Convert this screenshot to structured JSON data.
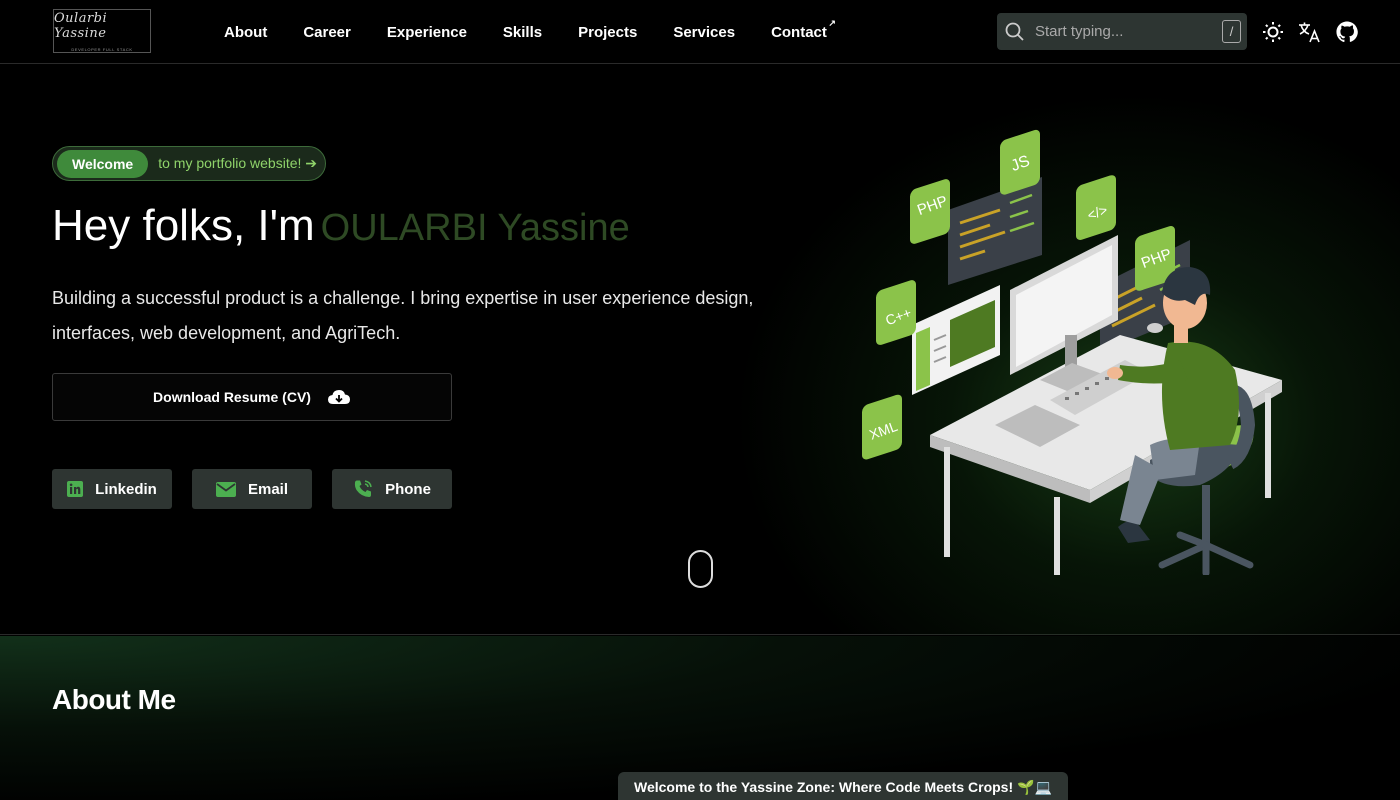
{
  "header": {
    "logo_text": "Oularbi Yassine",
    "logo_subtitle": "Developer Full Stack",
    "nav": [
      "About",
      "Career",
      "Experience",
      "Skills",
      "Projects",
      "Services",
      "Contact"
    ],
    "contact_external_marker": "↗",
    "search_placeholder": "Start typing...",
    "search_shortcut": "/"
  },
  "hero": {
    "welcome_badge": "Welcome",
    "welcome_text": "to my portfolio website! ➔",
    "greeting": "Hey folks, I'm",
    "name": "OULARBI Yassine",
    "description": "Building a successful product is a challenge. I bring expertise in user experience design, interfaces, web development, and AgriTech.",
    "cv_button": "Download Resume (CV)",
    "social": [
      "Linkedin",
      "Email",
      "Phone"
    ],
    "illustration_tags": [
      "JS",
      "PHP",
      "</>",
      "PHP",
      "C++",
      "XML"
    ]
  },
  "about": {
    "title": "About Me"
  },
  "toast": {
    "text": "Welcome to the Yassine Zone: Where Code Meets Crops! 🌱💻"
  },
  "colors": {
    "accent_green": "#3f8a3b",
    "light_green": "#8fd36a",
    "tag_green": "#8bc34a",
    "button_bg": "#2e3532"
  }
}
